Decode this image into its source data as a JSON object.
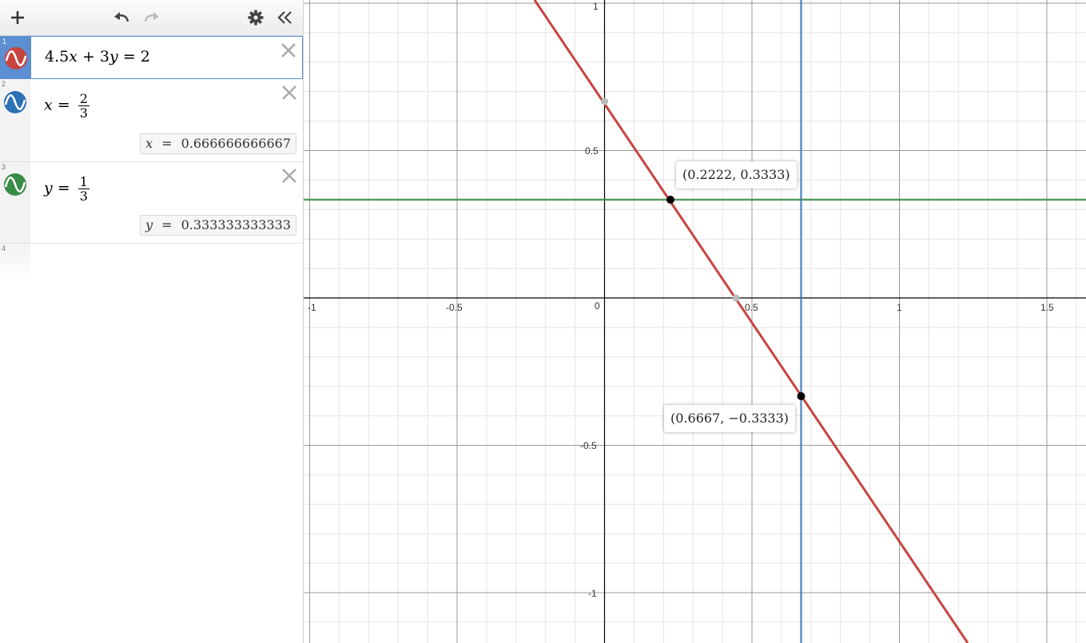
{
  "toolbar": {
    "add_icon": "plus-icon",
    "undo_icon": "undo-icon",
    "redo_icon": "redo-icon",
    "settings_icon": "gear-icon",
    "collapse_icon": "double-chevron-left-icon"
  },
  "expressions": [
    {
      "number": "1",
      "color": "#c74440",
      "latex": "4.5x + 3y = 2",
      "selected": true
    },
    {
      "number": "2",
      "color": "#2d70b3",
      "var": "x",
      "frac_num": "2",
      "frac_den": "3",
      "eval_var": "x",
      "eval_eq": "=",
      "eval_value": "0.666666666667"
    },
    {
      "number": "3",
      "color": "#388c46",
      "var": "y",
      "frac_num": "1",
      "frac_den": "3",
      "eval_var": "y",
      "eval_eq": "=",
      "eval_value": "0.333333333333"
    },
    {
      "number": "4"
    }
  ],
  "graph": {
    "x_ticks": [
      "-1",
      "-0.5",
      "0",
      "0.5",
      "1",
      "1.5"
    ],
    "y_ticks": [
      "1",
      "0.5",
      "-0.5",
      "-1"
    ],
    "point_labels": [
      {
        "text": "(0.2222, 0.3333)"
      },
      {
        "text": "(0.6667, −0.3333)"
      }
    ]
  }
}
